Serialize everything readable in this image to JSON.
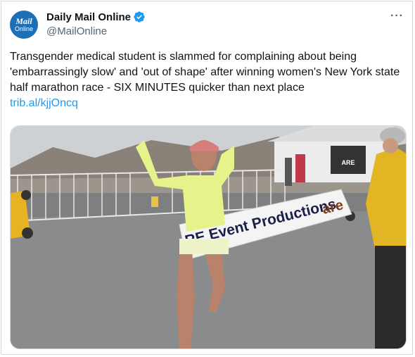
{
  "author": {
    "display_name": "Daily Mail Online",
    "handle": "@MailOnline",
    "avatar_line1": "Mail",
    "avatar_line2": "Online",
    "verified_icon": "verified-badge-icon"
  },
  "menu": {
    "more_label": "···"
  },
  "tweet": {
    "text": "Transgender medical student is slammed for complaining about being 'embarrassingly slow' and 'out of shape' after winning women's New York state half marathon race - SIX MINUTES quicker than next place",
    "link": "trib.al/kjjOncq"
  },
  "media": {
    "banner_text": "RE Event Productions",
    "banner_logo": "are",
    "building_sign": "ARE"
  },
  "colors": {
    "accent": "#1d9bf0",
    "avatar_bg": "#1d6fb8",
    "text": "#0f1419",
    "muted": "#536471"
  }
}
